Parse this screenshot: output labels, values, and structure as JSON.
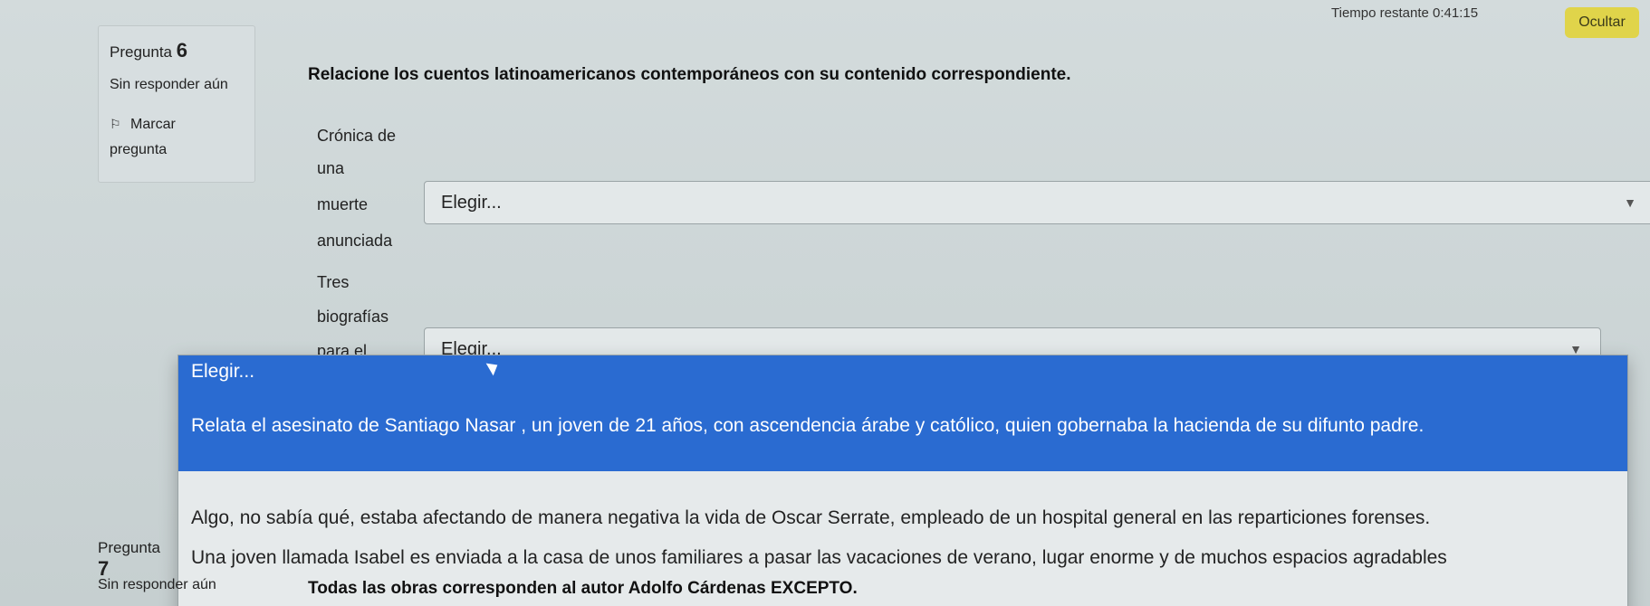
{
  "timer": {
    "label": "Tiempo restante 0:41:15",
    "hide_button": "Ocultar"
  },
  "question6": {
    "label_prefix": "Pregunta",
    "number": "6",
    "status": "Sin responder aún",
    "flag_line1": "Marcar",
    "flag_line2": "pregunta",
    "prompt": "Relacione los cuentos latinoamericanos contemporáneos con su contenido correspondiente.",
    "stems": [
      {
        "lines": [
          "Crónica de",
          "una",
          "muerte",
          "anunciada"
        ],
        "select_value": "Elegir..."
      },
      {
        "lines": [
          "Tres",
          "biografías",
          "para el"
        ],
        "select_value": "Elegir..."
      }
    ]
  },
  "dropdown": {
    "header": "Elegir...",
    "options": [
      "Relata el asesinato de Santiago Nasar , un joven de 21 años, con ascendencia árabe y católico, quien gobernaba la hacienda de su difunto padre.",
      "Algo, no sabía qué, estaba afectando de manera negativa la vida de Oscar Serrate, empleado de un hospital general en las reparticiones forenses.",
      "Una joven llamada Isabel es enviada a la casa de unos familiares a pasar las vacaciones de verano, lugar enorme y de muchos espacios agradables"
    ]
  },
  "question7": {
    "label_prefix": "Pregunta",
    "number": "7",
    "status": "Sin responder aún",
    "prompt": "Todas las obras corresponden al autor Adolfo Cárdenas EXCEPTO."
  },
  "colors": {
    "highlight": "#2a6bd1",
    "hide_button": "#e0d44a"
  }
}
